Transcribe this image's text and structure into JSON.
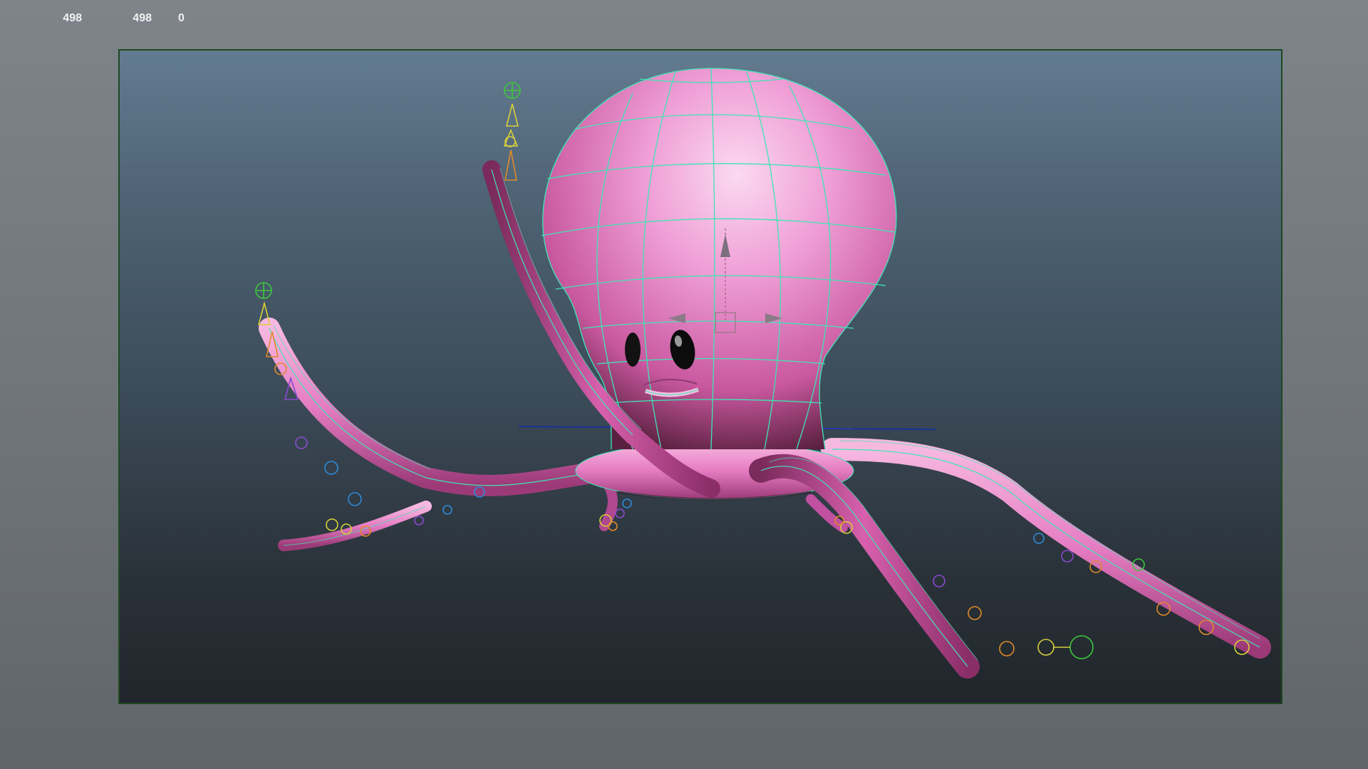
{
  "hud": {
    "rows": [
      {
        "values": [
          "",
          "",
          ""
        ]
      },
      {
        "values": [
          "498",
          "498",
          "0"
        ]
      }
    ]
  },
  "viewport": {
    "label": "",
    "subject": "octopus-rig"
  },
  "colors": {
    "background": "#6f7479",
    "viewport_border": "#1d4a1f",
    "viewport_top": "#637b90",
    "viewport_bottom": "#20262b",
    "octopus_body": "#e88ac8",
    "wireframe": "#3ee6b4",
    "control_green": "#3cc83c",
    "control_yellow": "#d8d03a",
    "control_orange": "#e08a2a",
    "control_purple": "#8a4ad0",
    "control_blue": "#2f8ad8"
  }
}
